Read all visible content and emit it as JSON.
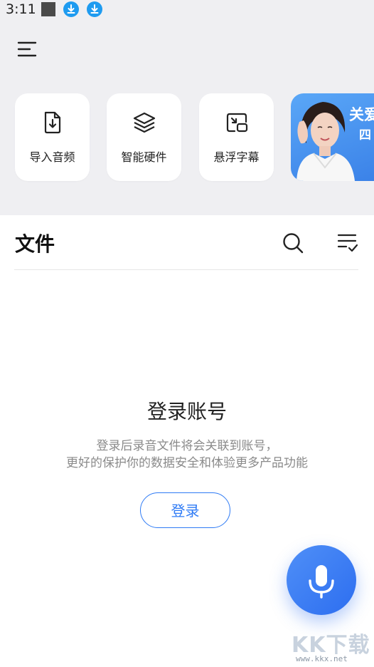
{
  "status_bar": {
    "time": "3:11"
  },
  "header": {
    "menu_icon": "hamburger-menu-icon"
  },
  "features": [
    {
      "label": "导入音频",
      "icon": "import-audio-file-icon"
    },
    {
      "label": "智能硬件",
      "icon": "layers-icon"
    },
    {
      "label": "悬浮字幕",
      "icon": "floating-window-icon"
    }
  ],
  "promo": {
    "text": "关爱",
    "sub_text": "四"
  },
  "files": {
    "title": "文件"
  },
  "empty_state": {
    "title": "登录账号",
    "description_line1": "登录后录音文件将会关联到账号，",
    "description_line2": "更好的保护你的数据安全和体验更多产品功能",
    "login_button": "登录"
  },
  "watermark": {
    "logo": "KK下载",
    "url": "www.kkx.net"
  },
  "colors": {
    "accent": "#2f7bf5",
    "top_background": "#efeff2",
    "download_badge": "#1e9bf0"
  }
}
